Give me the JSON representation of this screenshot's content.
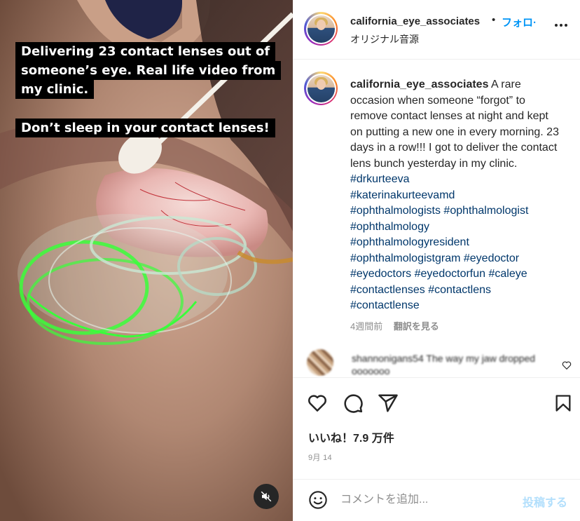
{
  "media": {
    "caption_lines": [
      "Delivering 23 contact lenses out of",
      "someone’s eye. Real life video from",
      "my clinic."
    ],
    "caption_warning": "Don’t sleep in your contact lenses!",
    "mute_icon": "speaker-muted-icon"
  },
  "header": {
    "username": "california_eye_associates",
    "separator": "•",
    "follow_label": "フォロ·",
    "audio_label": "オリジナル音源",
    "more_icon": "more-horizontal-icon"
  },
  "post": {
    "username": "california_eye_associates",
    "caption_text": "A rare occasion when someone “forgot” to remove contact lenses at night and kept on putting a new one in every morning. 23 days in a row!!! I got to deliver the contact lens bunch yesterday in my clinic.",
    "hashtags": [
      "#drkurteeva",
      "#katerinakurteevamd",
      "#ophthalmologists",
      "#ophthalmologist",
      "#ophthalmology",
      "#ophthalmologyresident",
      "#ophthalmologistgram",
      "#eyedoctor",
      "#eyedoctors",
      "#eyedoctorfun",
      "#caleye",
      "#contactlenses",
      "#contactlens",
      "#contactlense"
    ],
    "time_ago": "4週間前",
    "translate_label": "翻訳を見る"
  },
  "comment": {
    "text": "shannonigans54 The way my jaw dropped",
    "second_line": "ооооооо",
    "like_icon": "heart-outline-icon"
  },
  "actions": {
    "like_icon": "heart-icon",
    "comment_icon": "comment-bubble-icon",
    "share_icon": "paper-plane-icon",
    "save_icon": "bookmark-icon",
    "likes_text": "いいね！7.9 万件",
    "date_text": "9月 14"
  },
  "add_comment": {
    "emoji_icon": "smiley-icon",
    "placeholder": "コメントを追加...",
    "post_label": "投稿する"
  },
  "colors": {
    "link_blue": "#0095f6",
    "hashtag": "#00376b",
    "muted_text": "#8e8e8e",
    "post_disabled": "#b2dffc",
    "lens_green": "#39ff3a"
  }
}
